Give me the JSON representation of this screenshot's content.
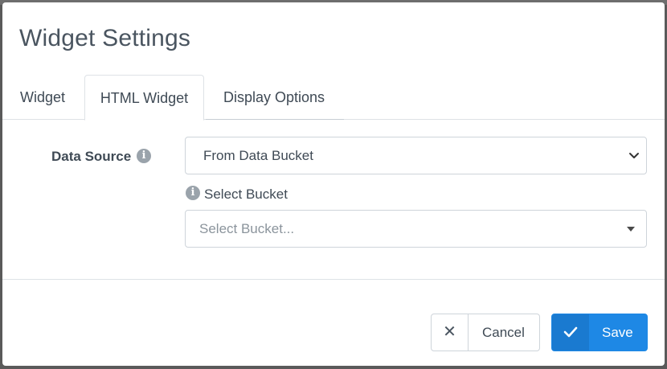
{
  "modal": {
    "title": "Widget Settings"
  },
  "tabs": [
    {
      "label": "Widget"
    },
    {
      "label": "HTML Widget",
      "active": true
    },
    {
      "label": "Display Options"
    }
  ],
  "form": {
    "data_source": {
      "label": "Data Source",
      "value": "From Data Bucket"
    },
    "select_bucket": {
      "label": "Select Bucket",
      "placeholder": "Select Bucket..."
    }
  },
  "footer": {
    "cancel_label": "Cancel",
    "save_label": "Save"
  },
  "colors": {
    "primary": "#1e88e5",
    "text": "#3f4a55",
    "info_icon": "#9aa3ab"
  },
  "icons": {
    "info": "info-icon",
    "close": "close-icon",
    "check": "check-icon",
    "chevron": "chevron-down-icon",
    "caret": "caret-down-icon"
  }
}
